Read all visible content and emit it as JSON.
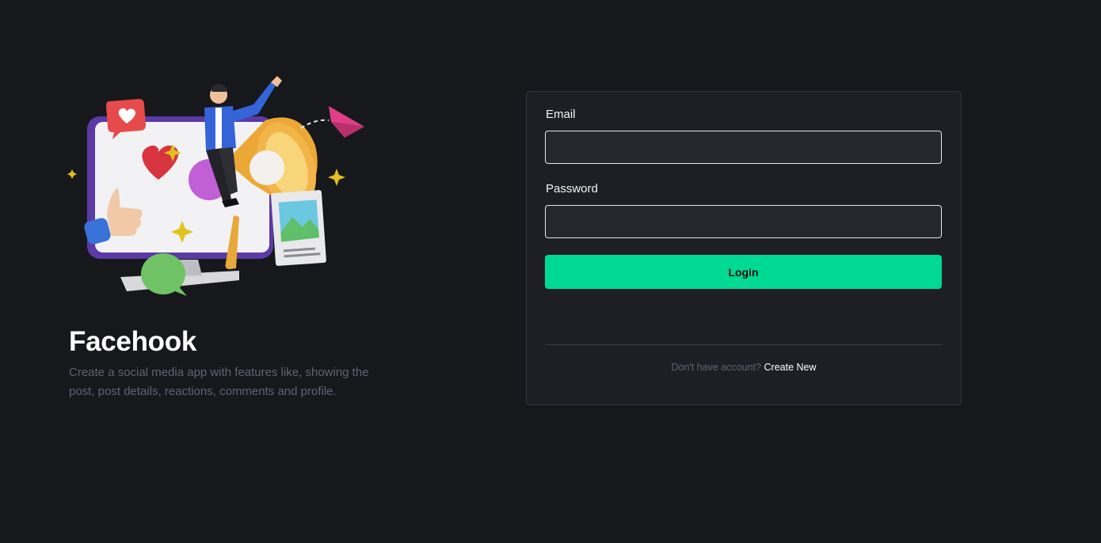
{
  "hero": {
    "title": "Facehook",
    "description": "Create a social media app with features like, showing the post, post details, reactions, comments and profile."
  },
  "login_form": {
    "email_label": "Email",
    "email_value": "",
    "password_label": "Password",
    "password_value": "",
    "submit_label": "Login",
    "signup_prompt": "Don't have account?",
    "signup_link": "Create New"
  },
  "colors": {
    "background": "#17181c",
    "card": "#1e1f24",
    "accent": "#00d991",
    "muted_text": "#5e6473"
  },
  "icons": {
    "illustration": "social-media-megaphone-illustration"
  }
}
